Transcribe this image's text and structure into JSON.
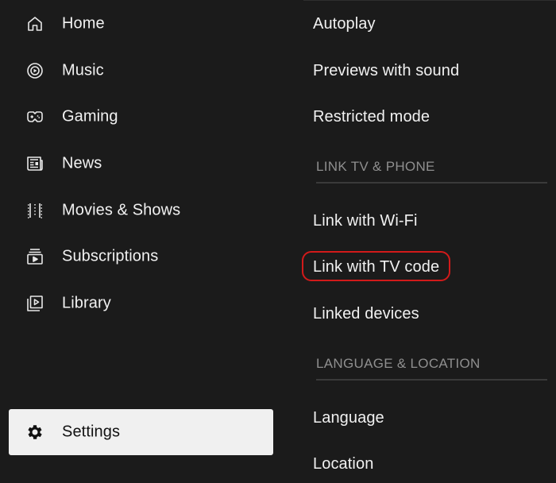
{
  "sidebar": {
    "items": [
      {
        "label": "Home",
        "icon": "home-icon"
      },
      {
        "label": "Music",
        "icon": "music-icon"
      },
      {
        "label": "Gaming",
        "icon": "gaming-icon"
      },
      {
        "label": "News",
        "icon": "news-icon"
      },
      {
        "label": "Movies & Shows",
        "icon": "film-icon"
      },
      {
        "label": "Subscriptions",
        "icon": "subscriptions-icon"
      },
      {
        "label": "Library",
        "icon": "library-icon"
      }
    ],
    "settings": {
      "label": "Settings",
      "icon": "gear-icon",
      "selected": true
    }
  },
  "settings_panel": {
    "items_top": [
      "Autoplay",
      "Previews with sound",
      "Restricted mode"
    ],
    "section_link": {
      "header": "LINK TV & PHONE",
      "items": [
        "Link with Wi-Fi",
        "Link with TV code",
        "Linked devices"
      ]
    },
    "section_language": {
      "header": "LANGUAGE & LOCATION",
      "items": [
        "Language",
        "Location"
      ]
    },
    "highlighted_item": "Link with TV code"
  },
  "colors": {
    "background": "#1b1b1b",
    "text": "#f1f1f1",
    "section_header": "#8f8f8f",
    "selected_bg": "#f0f0f0",
    "highlight_ring": "#d21a1a"
  }
}
